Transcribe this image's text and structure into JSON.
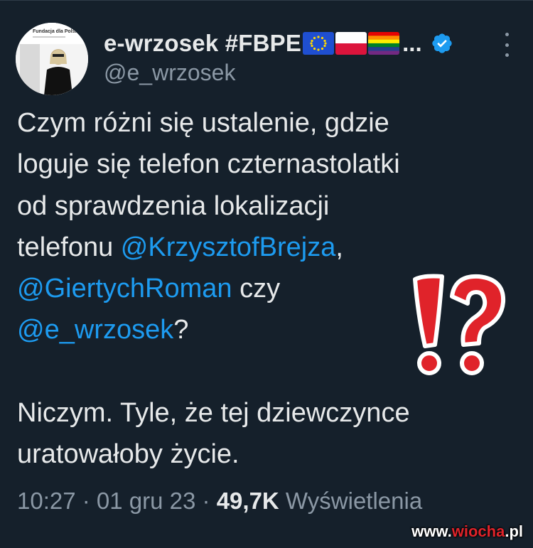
{
  "tweet": {
    "author": {
      "display_name": "e-wrzosek #FBPE",
      "name_truncation": "...",
      "handle": "@e_wrzosek",
      "flags": [
        "eu-flag-icon",
        "poland-flag-icon",
        "rainbow-flag-icon"
      ],
      "verified": true,
      "avatar_text": "Fundacja dla Polski"
    },
    "text": {
      "line1": "Czym różni się ustalenie, gdzie",
      "line2": "loguje się  telefon czternastolatki",
      "line3": "od sprawdzenia lokalizacji",
      "line4_prefix": "telefonu ",
      "mention1": "@KrzysztofBrejza",
      "line4_suffix": ",",
      "mention2": "@GiertychRoman",
      "line5_suffix": " czy",
      "mention3": "@e_wrzosek",
      "line6_suffix": "?",
      "para2_line1": "Niczym. Tyle, że tej dziewczynce",
      "para2_line2": "uratowałoby życie."
    },
    "meta": {
      "time": "10:27",
      "separator": " · ",
      "date": "01 gru 23",
      "views_count": "49,7K",
      "views_label": " Wyświetlenia"
    },
    "emoji": "exclamation-question-mark-icon"
  },
  "watermark": {
    "prefix": "www.",
    "site": "wiocha",
    "suffix": ".pl"
  },
  "colors": {
    "background": "#15202b",
    "text": "#e7e9ea",
    "secondary": "#8b98a5",
    "link": "#1d9bf0",
    "verified": "#1d9bf0",
    "emoji_red": "#e0232a"
  }
}
